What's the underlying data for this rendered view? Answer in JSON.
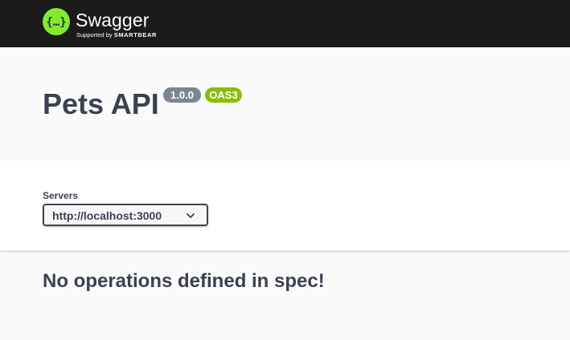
{
  "topbar": {
    "logo_text": "Swagger",
    "logo_tm": "™",
    "logo_sub_prefix": "Supported by",
    "logo_sub_brand": "SMARTBEAR",
    "logo_icon": "swagger-braces-icon",
    "brand_color": "#85ea2d",
    "background": "#1b1b1b"
  },
  "info": {
    "title": "Pets API",
    "version_badge": "1.0.0",
    "oas_badge": "OAS3",
    "version_badge_color": "#7d8492",
    "oas_badge_color": "#89bf04"
  },
  "servers": {
    "label": "Servers",
    "selected": "http://localhost:3000",
    "dropdown_icon": "chevron-down-icon"
  },
  "operations": {
    "empty_message": "No operations defined in spec!"
  }
}
